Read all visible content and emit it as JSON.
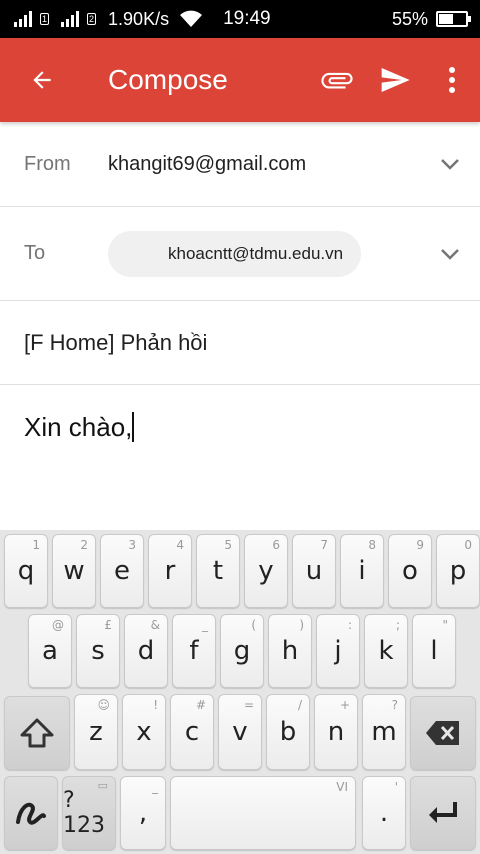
{
  "status_bar": {
    "sim1": "1",
    "sim2": "2",
    "net_speed": "1.90K/s",
    "time": "19:49",
    "battery_text": "55%",
    "battery_level": 0.55
  },
  "app_bar": {
    "title": "Compose",
    "color": "#db4437"
  },
  "compose": {
    "from_label": "From",
    "from_value": "khangit69@gmail.com",
    "to_label": "To",
    "to_chip": "khoacntt@tdmu.edu.vn",
    "subject": "[F Home] Phản hồi",
    "body": "Xin chào,"
  },
  "keyboard": {
    "row1": [
      {
        "k": "q",
        "h": "1"
      },
      {
        "k": "w",
        "h": "2"
      },
      {
        "k": "e",
        "h": "3"
      },
      {
        "k": "r",
        "h": "4"
      },
      {
        "k": "t",
        "h": "5"
      },
      {
        "k": "y",
        "h": "6"
      },
      {
        "k": "u",
        "h": "7"
      },
      {
        "k": "i",
        "h": "8"
      },
      {
        "k": "o",
        "h": "9"
      },
      {
        "k": "p",
        "h": "0"
      }
    ],
    "row2": [
      {
        "k": "a",
        "h": "@"
      },
      {
        "k": "s",
        "h": "£"
      },
      {
        "k": "d",
        "h": "&"
      },
      {
        "k": "f",
        "h": "_"
      },
      {
        "k": "g",
        "h": "("
      },
      {
        "k": "h",
        "h": ")"
      },
      {
        "k": "j",
        "h": ":"
      },
      {
        "k": "k",
        "h": ";"
      },
      {
        "k": "l",
        "h": "\""
      }
    ],
    "row3": [
      {
        "k": "z",
        "h": "☺"
      },
      {
        "k": "x",
        "h": "!"
      },
      {
        "k": "c",
        "h": "#"
      },
      {
        "k": "v",
        "h": "="
      },
      {
        "k": "b",
        "h": "/"
      },
      {
        "k": "n",
        "h": "+"
      },
      {
        "k": "m",
        "h": "?"
      }
    ],
    "symbols_label": "?123",
    "comma_label": ",",
    "comma_hint": "_",
    "space_hint": "VI",
    "period_label": ".",
    "period_hint": "'"
  }
}
